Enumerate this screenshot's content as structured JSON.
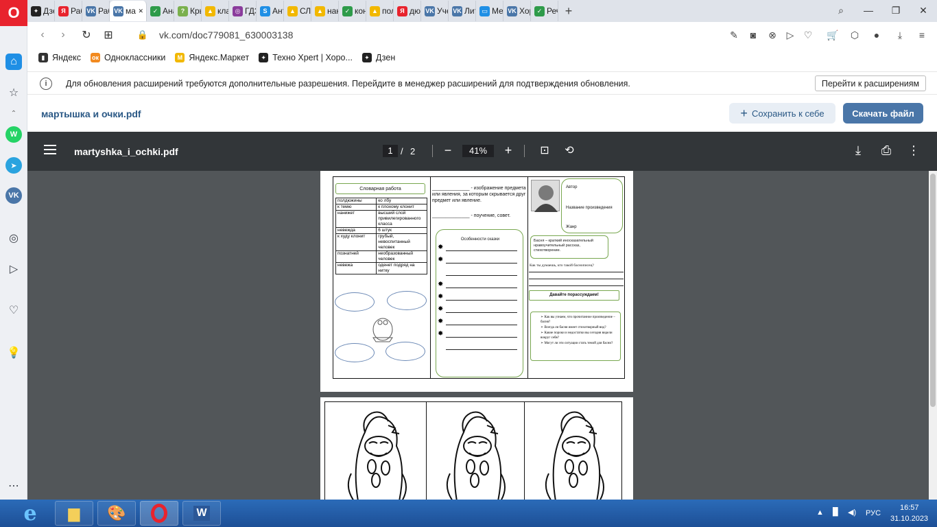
{
  "browser": {
    "tabs": [
      {
        "label": "Дзен",
        "color": "#222222",
        "glyph": "✦"
      },
      {
        "label": "Раб",
        "color": "#e8232d",
        "glyph": "Я"
      },
      {
        "label": "Раб",
        "color": "#4a76a8",
        "glyph": "VK"
      },
      {
        "label": "ма",
        "color": "#4a76a8",
        "glyph": "VK",
        "active": true
      },
      {
        "label": "Ана",
        "color": "#2e9b4a",
        "glyph": "✓"
      },
      {
        "label": "Кры",
        "color": "#7ab04d",
        "glyph": "?"
      },
      {
        "label": "клас",
        "color": "#f2b800",
        "glyph": "▲"
      },
      {
        "label": "ГДЗ",
        "color": "#8a3b9c",
        "glyph": "◎"
      },
      {
        "label": "Анто",
        "color": "#1f8fe5",
        "glyph": "S"
      },
      {
        "label": "СЛО",
        "color": "#f2b800",
        "glyph": "▲"
      },
      {
        "label": "нан",
        "color": "#f2b800",
        "glyph": "▲"
      },
      {
        "label": "конс",
        "color": "#2e9b4a",
        "glyph": "✓"
      },
      {
        "label": "пол",
        "color": "#f2b800",
        "glyph": "▲"
      },
      {
        "label": "дюж",
        "color": "#e8232d",
        "glyph": "Я"
      },
      {
        "label": "Учеб",
        "color": "#4a76a8",
        "glyph": "VK"
      },
      {
        "label": "Лите",
        "color": "#4a76a8",
        "glyph": "VK"
      },
      {
        "label": "Мес",
        "color": "#1f8fe5",
        "glyph": "▭"
      },
      {
        "label": "Хор",
        "color": "#4a76a8",
        "glyph": "VK"
      },
      {
        "label": "Рече",
        "color": "#2e9b4a",
        "glyph": "✓"
      }
    ],
    "url": "vk.com/doc779081_630003138",
    "bookmarks": [
      {
        "label": "Яндекс",
        "color": "#333333",
        "glyph": "▮"
      },
      {
        "label": "Одноклассники",
        "color": "#f28a1f",
        "glyph": "ок"
      },
      {
        "label": "Яндекс.Маркет",
        "color": "#f2b800",
        "glyph": "M"
      },
      {
        "label": "Техно Xpert | Хоро...",
        "color": "#222222",
        "glyph": "✦"
      },
      {
        "label": "Дзен",
        "color": "#222222",
        "glyph": "✦"
      }
    ],
    "infobar": {
      "message": "Для обновления расширений требуются дополнительные разрешения. Перейдите в менеджер расширений для подтверждения обновления.",
      "button": "Перейти к расширениям"
    }
  },
  "vk": {
    "file_name": "мартышка и очки.pdf",
    "save_label": "Сохранить к себе",
    "download_label": "Скачать файл"
  },
  "pdf": {
    "title": "martyshka_i_ochki.pdf",
    "page": "1",
    "separator": "/",
    "total": "2",
    "zoom": "41%"
  },
  "page1": {
    "vocab_title": "Словарная работа",
    "vocab_rows": [
      [
        "полдюжины",
        "ко лбу"
      ],
      [
        "к темю",
        "к плохому клонит"
      ],
      [
        "нанижет",
        "высший слой привилегированного класса"
      ],
      [
        "невежда",
        "6 штук"
      ],
      [
        "к худу клонит",
        "грубый, невоспитанный человек"
      ],
      [
        "познатней",
        "необразованный человек"
      ],
      [
        "невежа",
        "оденет подряд на нитку"
      ]
    ],
    "def_text_1": "______________ - изображение предмета или явления, за которым скрывается друг предмет или явление.",
    "def_text_2": "______________ - поучение, совет.",
    "features_title": "Особенности сказки",
    "author_label": "Автор",
    "work_label": "Название произведения",
    "genre_label": "Жанр",
    "fable_def": "Басня – краткий иносказательный нравоучительный рассказ, стихотворение.",
    "question": "Как ты думаешь, кто такой баснописец?",
    "discuss_title": "Давайте порассуждаем!",
    "discuss_items": [
      "Как вы узнаем, что прочитанное произведение – басня?",
      "Всегда ли басня имеет стихотворный вид?",
      "Какие пороки и недостатки вы сегодня видели вокруг себя?",
      "Могут ли эти ситуации стать темой для басни?"
    ]
  },
  "taskbar": {
    "lang": "РУС",
    "time": "16:57",
    "date": "31.10.2023"
  }
}
